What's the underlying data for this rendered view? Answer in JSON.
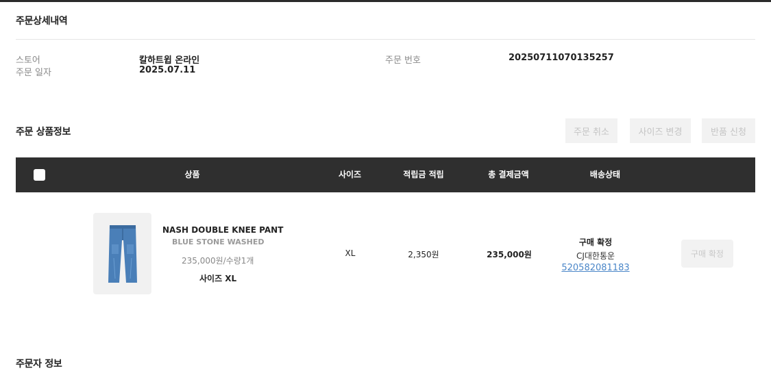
{
  "sections": {
    "order_detail_title": "주문상세내역",
    "product_info_title": "주문 상품정보",
    "orderer_info_title": "주문자 정보"
  },
  "order_info": {
    "store_label": "스토어",
    "store_value": "칼하트윕 온라인",
    "date_label": "주문 일자",
    "date_value": "2025.07.11",
    "number_label": "주문 번호",
    "number_value": "20250711070135257"
  },
  "actions": {
    "cancel": "주문 취소",
    "size_change": "사이즈 변경",
    "return": "반품 신청"
  },
  "table": {
    "headers": {
      "product": "상품",
      "size": "사이즈",
      "points": "적립금 적립",
      "total": "총 결제금액",
      "status": "배송상태"
    }
  },
  "item": {
    "name": "NASH DOUBLE KNEE PANT",
    "color": "BLUE STONE WASHED",
    "price_qty": "235,000원/수량1개",
    "size_line": "사이즈 XL",
    "size": "XL",
    "points": "2,350원",
    "total": "235,000원",
    "status": "구매 확정",
    "carrier": "CJ대한통운",
    "tracking": "520582081183",
    "confirm_button": "구매 확정",
    "thumbnail_icon": "jeans-icon",
    "jeans_color": "#4a7fb8"
  }
}
